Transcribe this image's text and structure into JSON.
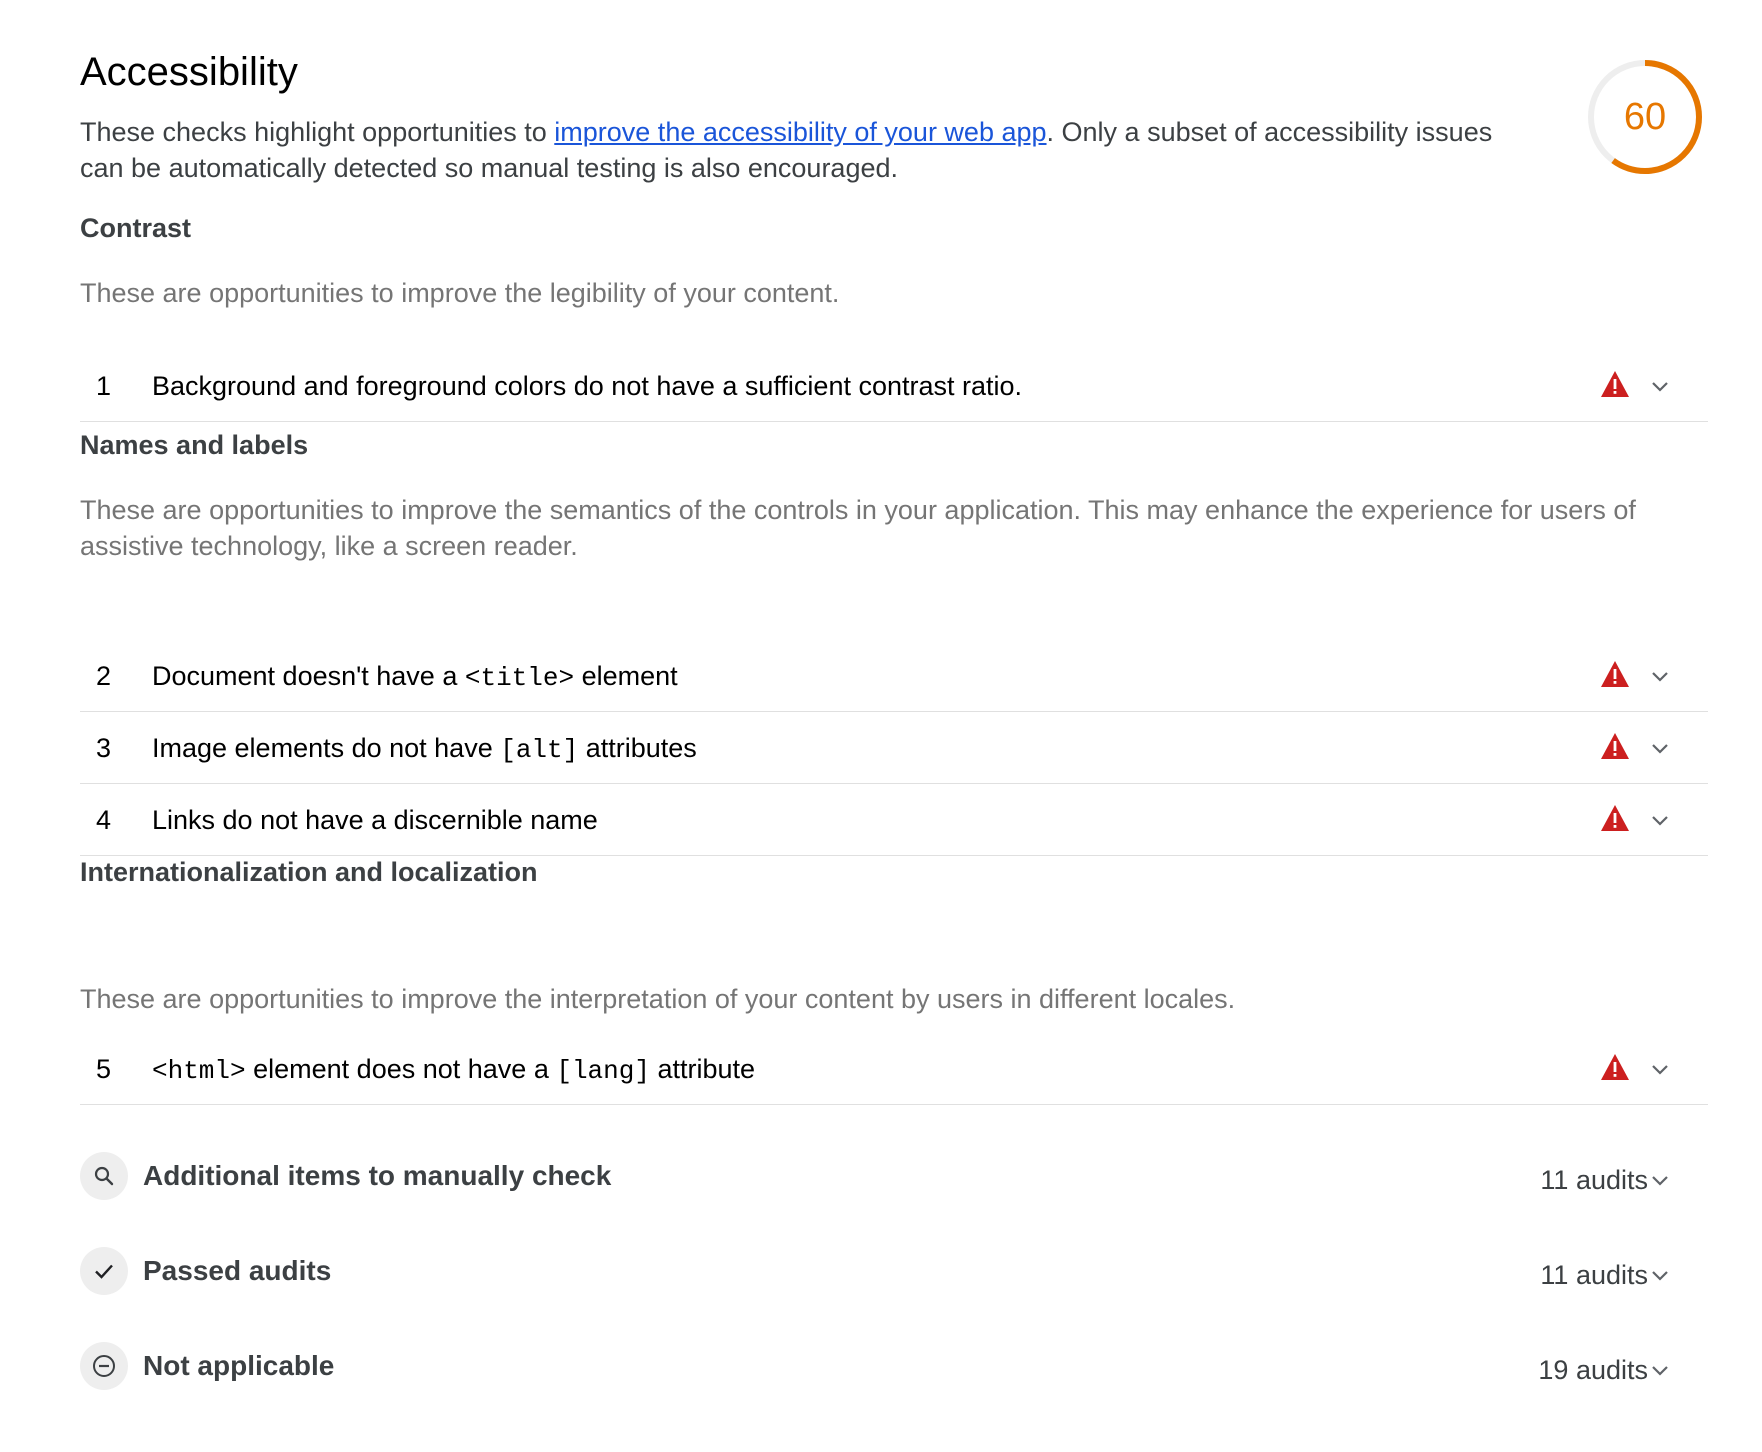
{
  "category": {
    "title": "Accessibility",
    "description_before": "These checks highlight opportunities to ",
    "description_link": "improve the accessibility of your web app",
    "description_after": ". Only a subset of accessibility issues can be automatically detected so manual testing is also encouraged.",
    "score": "60",
    "score_fraction": 0.6,
    "score_color": "#e67700"
  },
  "groups": [
    {
      "title": "Contrast",
      "description": "These are opportunities to improve the legibility of your content.",
      "audits": [
        {
          "num": "1",
          "title_parts": [
            "Background and foreground colors do not have a sufficient contrast ratio."
          ]
        }
      ]
    },
    {
      "title": "Names and labels",
      "description": "These are opportunities to improve the semantics of the controls in your application. This may enhance the experience for users of assistive technology, like a screen reader.",
      "audits": [
        {
          "num": "2",
          "title_parts": [
            "Document doesn't have a ",
            "<title>",
            " element"
          ]
        },
        {
          "num": "3",
          "title_parts": [
            "Image elements do not have ",
            "[alt]",
            " attributes"
          ]
        },
        {
          "num": "4",
          "title_parts": [
            "Links do not have a discernible name"
          ]
        }
      ]
    },
    {
      "title": "Internationalization and localization",
      "description": "These are opportunities to improve the interpretation of your content by users in different locales.",
      "audits": [
        {
          "num": "5",
          "title_parts": [
            "",
            "<html>",
            " element does not have a ",
            "[lang]",
            " attribute"
          ]
        }
      ]
    }
  ],
  "clumps": [
    {
      "title": "Additional items to manually check",
      "count": "11 audits",
      "icon": "search-icon"
    },
    {
      "title": "Passed audits",
      "count": "11 audits",
      "icon": "check-icon"
    },
    {
      "title": "Not applicable",
      "count": "19 audits",
      "icon": "minus-circle-icon"
    }
  ],
  "colors": {
    "fail": "#cc1f1f",
    "link": "#1a55d9",
    "gauge_track": "#eeeeee"
  }
}
